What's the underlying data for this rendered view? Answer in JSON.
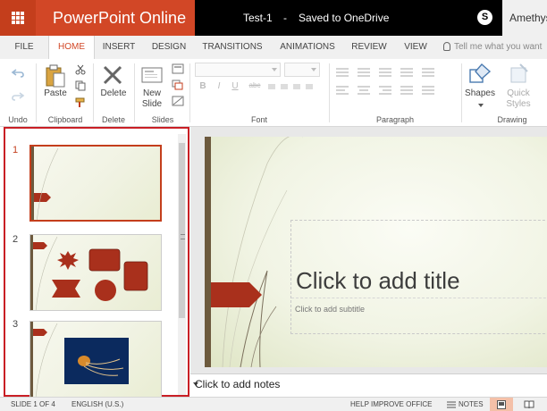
{
  "app": {
    "name": "PowerPoint Online",
    "doc_name": "Test-1",
    "separator": "-",
    "status": "Saved to OneDrive",
    "user": "Amethyst"
  },
  "colors": {
    "brand": "#d24726",
    "waffle": "#c43e1c",
    "selection": "#c91f25",
    "accent_shape": "#a9301c",
    "slide_bar": "#6d5a3e"
  },
  "tabs": [
    {
      "label": "FILE"
    },
    {
      "label": "HOME",
      "active": true
    },
    {
      "label": "INSERT"
    },
    {
      "label": "DESIGN"
    },
    {
      "label": "TRANSITIONS"
    },
    {
      "label": "ANIMATIONS"
    },
    {
      "label": "REVIEW"
    },
    {
      "label": "VIEW"
    }
  ],
  "tell_me": {
    "placeholder": "Tell me what you want"
  },
  "ribbon": {
    "groups": {
      "undo": "Undo",
      "clipboard": "Clipboard",
      "delete": "Delete",
      "slides": "Slides",
      "font": "Font",
      "paragraph": "Paragraph",
      "drawing": "Drawing"
    },
    "buttons": {
      "paste": "Paste",
      "delete": "Delete",
      "new_slide_1": "New",
      "new_slide_2": "Slide",
      "shapes": "Shapes",
      "quick_styles_1": "Quick",
      "quick_styles_2": "Styles"
    },
    "font_buttons": {
      "bold": "B",
      "italic": "I",
      "underline": "U",
      "strike": "abc"
    }
  },
  "thumbnails": [
    {
      "num": "1",
      "selected": true
    },
    {
      "num": "2"
    },
    {
      "num": "3"
    }
  ],
  "slide": {
    "title_placeholder": "Click to add title",
    "subtitle_placeholder": "Click to add subtitle"
  },
  "notes": {
    "placeholder": "Click to add notes"
  },
  "status": {
    "slide_info": "SLIDE 1 OF 4",
    "language": "ENGLISH (U.S.)",
    "help": "HELP IMPROVE OFFICE",
    "notes": "NOTES"
  }
}
